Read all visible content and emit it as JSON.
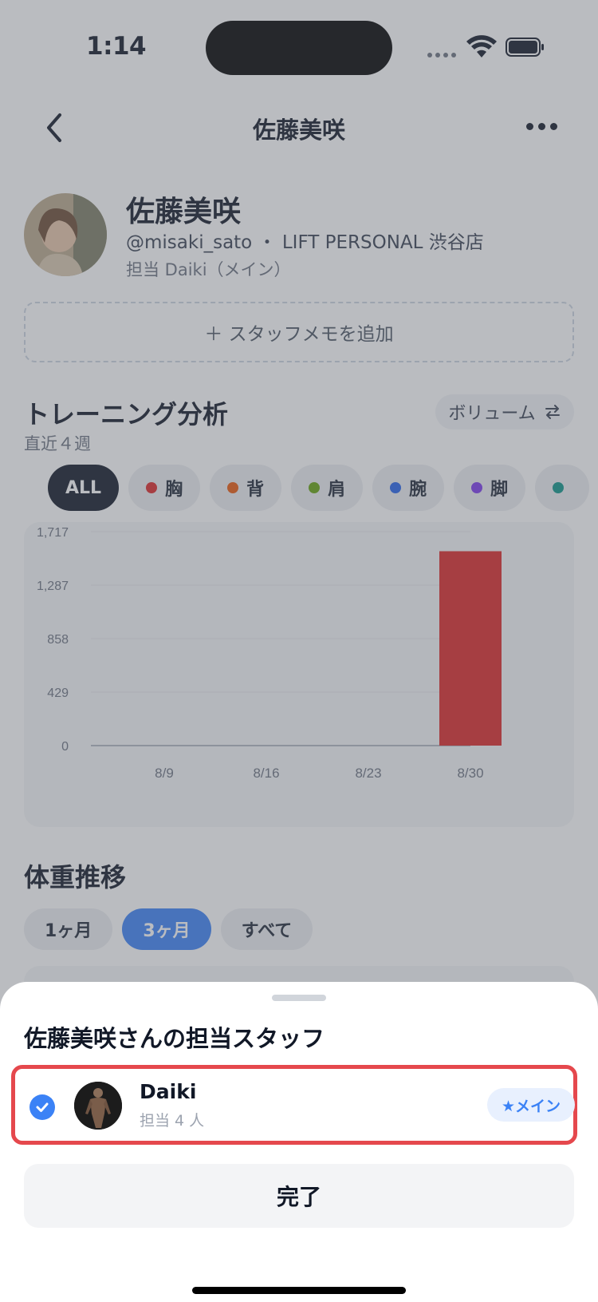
{
  "status_bar": {
    "time": "1:14"
  },
  "nav": {
    "title": "佐藤美咲",
    "back_icon": "chevron-left-icon",
    "more_icon": "ellipsis-icon"
  },
  "profile": {
    "name": "佐藤美咲",
    "meta": "@misaki_sato ・ LIFT PERSONAL 渋谷店",
    "staff": "担当 Daiki（メイン）",
    "memo_button": "＋ スタッフメモを追加"
  },
  "training": {
    "title": "トレーニング分析",
    "subtitle": "直近４週",
    "volume_label": "ボリューム",
    "volume_icon": "swap-arrows-icon",
    "chips": [
      {
        "label": "ALL",
        "color": ""
      },
      {
        "label": "胸",
        "color": "#dc2626"
      },
      {
        "label": "背",
        "color": "#ea580c"
      },
      {
        "label": "肩",
        "color": "#65a30d"
      },
      {
        "label": "腕",
        "color": "#2563eb"
      },
      {
        "label": "脚",
        "color": "#7c3aed"
      },
      {
        "label": "",
        "color": "#0d9488"
      }
    ]
  },
  "chart_data": {
    "type": "bar",
    "categories": [
      "8/9",
      "8/16",
      "8/23",
      "8/30"
    ],
    "values": [
      0,
      0,
      0,
      1560
    ],
    "yticks": [
      "1,717",
      "1,287",
      "858",
      "429",
      "0"
    ],
    "ylim": [
      0,
      1717
    ],
    "bar_color": "#dc2626",
    "title": "",
    "xlabel": "",
    "ylabel": ""
  },
  "weight": {
    "title": "体重推移",
    "ranges": [
      "1ヶ月",
      "3ヶ月",
      "すべて"
    ],
    "active_range": "3ヶ月"
  },
  "sheet": {
    "title": "佐藤美咲さんの担当スタッフ",
    "staff": {
      "name": "Daiki",
      "count": "担当 4 人",
      "badge": "★メイン",
      "selected": true
    },
    "done_button": "完了"
  }
}
